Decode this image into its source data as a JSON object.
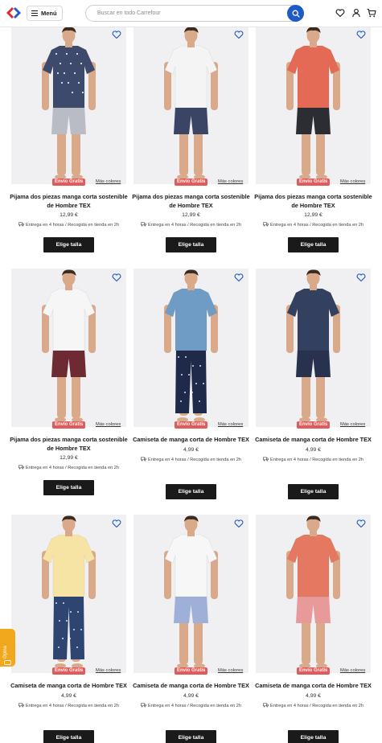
{
  "header": {
    "menu_label": "Menú",
    "search_placeholder": "Buscar en todo Carrefour",
    "icons": [
      "carrefour-logo",
      "menu-icon",
      "search-icon",
      "heart-icon",
      "user-icon",
      "cart-icon"
    ]
  },
  "products": [
    {
      "title": "Pijama dos piezas manga corta sostenible de Hombre TEX",
      "price": "12,99 €",
      "badge": "Envío Gratis",
      "colors_link": "Más colores",
      "delivery": "Entrega en 4 horas / Recogida en tienda en 2h",
      "button": "Elige talla",
      "shirt": "#3d4a6b",
      "bottom": "#b9bcc4",
      "pattern": "shirt",
      "shorts": true
    },
    {
      "title": "Pijama dos piezas manga corta sostenible de Hombre TEX",
      "price": "12,99 €",
      "badge": "Envío Gratis",
      "colors_link": "Más colores",
      "delivery": "Entrega en 4 horas / Recogida en tienda en 2h",
      "button": "Elige talla",
      "shirt": "#f4f4f4",
      "bottom": "#3a4566",
      "pattern": "",
      "shorts": true
    },
    {
      "title": "Pijama dos piezas manga corta sostenible de Hombre TEX",
      "price": "12,99 €",
      "badge": "Envío Gratis",
      "colors_link": "Más colores",
      "delivery": "Entrega en 4 horas / Recogida en tienda en 2h",
      "button": "Elige talla",
      "shirt": "#e56a55",
      "bottom": "#2b2d33",
      "pattern": "",
      "shorts": true
    },
    {
      "title": "Pijama dos piezas manga corta sostenible de Hombre TEX",
      "price": "12,99 €",
      "badge": "Envío Gratis",
      "colors_link": "Más colores",
      "delivery": "Entrega en 4 horas / Recogida en tienda en 2h",
      "button": "Elige talla",
      "shirt": "#f6f6f6",
      "bottom": "#6e2a33",
      "pattern": "",
      "shorts": true
    },
    {
      "title": "Camiseta de manga corta de Hombre TEX",
      "price": "4,99 €",
      "badge": "Envío Gratis",
      "colors_link": "Más colores",
      "delivery": "Entrega en 4 horas / Recogida en tienda en 2h",
      "button": "Elige talla",
      "shirt": "#6f9cc4",
      "bottom": "#1f2a4a",
      "pattern": "bottom",
      "shorts": false
    },
    {
      "title": "Camiseta de manga corta de Hombre TEX",
      "price": "4,99 €",
      "badge": "Envío Gratis",
      "colors_link": "Más colores",
      "delivery": "Entrega en 4 horas / Recogida en tienda en 2h",
      "button": "Elige talla",
      "shirt": "#33405f",
      "bottom": "#28324f",
      "pattern": "bottom",
      "shorts": true
    },
    {
      "title": "Camiseta de manga corta de Hombre TEX",
      "price": "4,99 €",
      "badge": "Envío Gratis",
      "colors_link": "Más colores",
      "delivery": "Entrega en 4 horas / Recogida en tienda en 2h",
      "button": "Elige talla",
      "shirt": "#f6e4a4",
      "bottom": "#2e4572",
      "pattern": "bottom",
      "shorts": false
    },
    {
      "title": "Camiseta de manga corta de Hombre TEX",
      "price": "4,99 €",
      "badge": "Envío Gratis",
      "colors_link": "Más colores",
      "delivery": "Entrega en 4 horas / Recogida en tienda en 2h",
      "button": "Elige talla",
      "shirt": "#f7f7f7",
      "bottom": "#9fb0d8",
      "pattern": "bottom",
      "shorts": true
    },
    {
      "title": "Camiseta de manga corta de Hombre TEX",
      "price": "4,99 €",
      "badge": "Envío Gratis",
      "colors_link": "Más colores",
      "delivery": "Entrega en 4 horas / Recogida en tienda en 2h",
      "button": "Elige talla",
      "shirt": "#e57860",
      "bottom": "#e8999a",
      "pattern": "bottom",
      "shorts": true
    }
  ],
  "feedback_tab": "Opina",
  "colors": {
    "brand_blue": "#1e5bc6",
    "badge_red": "#e35a5a",
    "button_black": "#1a1a1a",
    "feedback_orange": "#f2a81d"
  }
}
